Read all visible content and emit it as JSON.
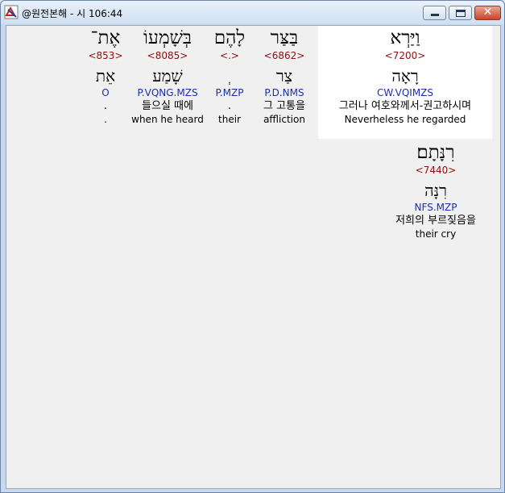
{
  "window": {
    "title": "@원전본해 - 시 106:44"
  },
  "controls": {
    "close_glyph": "✕"
  },
  "words": [
    {
      "hebrew": "וַיַּרְא",
      "strong": "<7200>",
      "root": "רָאָה",
      "morph": "CW.VQIMZS",
      "korean": "그러나 여호와께서-권고하시며",
      "english": "Neverheless he regarded"
    },
    {
      "hebrew": "בַּצַּר",
      "strong": "<6862>",
      "root": "צַר",
      "morph": "P.D.NMS",
      "korean": "그 고통을",
      "english": "affliction"
    },
    {
      "hebrew": "לָהֶם",
      "strong": "<.>",
      "root": "ְ",
      "morph": "P.MZP",
      "korean": ".",
      "english": "their"
    },
    {
      "hebrew": "בְּשָׁמְעוֹ",
      "strong": "<8085>",
      "root": "שָׁמַע",
      "morph": "P.VQNG.MZS",
      "korean": "들으실 때에",
      "english": "when he heard"
    },
    {
      "hebrew": "אֶת־",
      "strong": "<853>",
      "root": "אֵת",
      "morph": "O",
      "korean": ".",
      "english": "."
    },
    {
      "hebrew": "רִנָּתָם׃",
      "strong": "<7440>",
      "root": "רִנָּה",
      "morph": "NFS.MZP",
      "korean": "저희의 부르짖음을",
      "english": "their cry"
    }
  ]
}
